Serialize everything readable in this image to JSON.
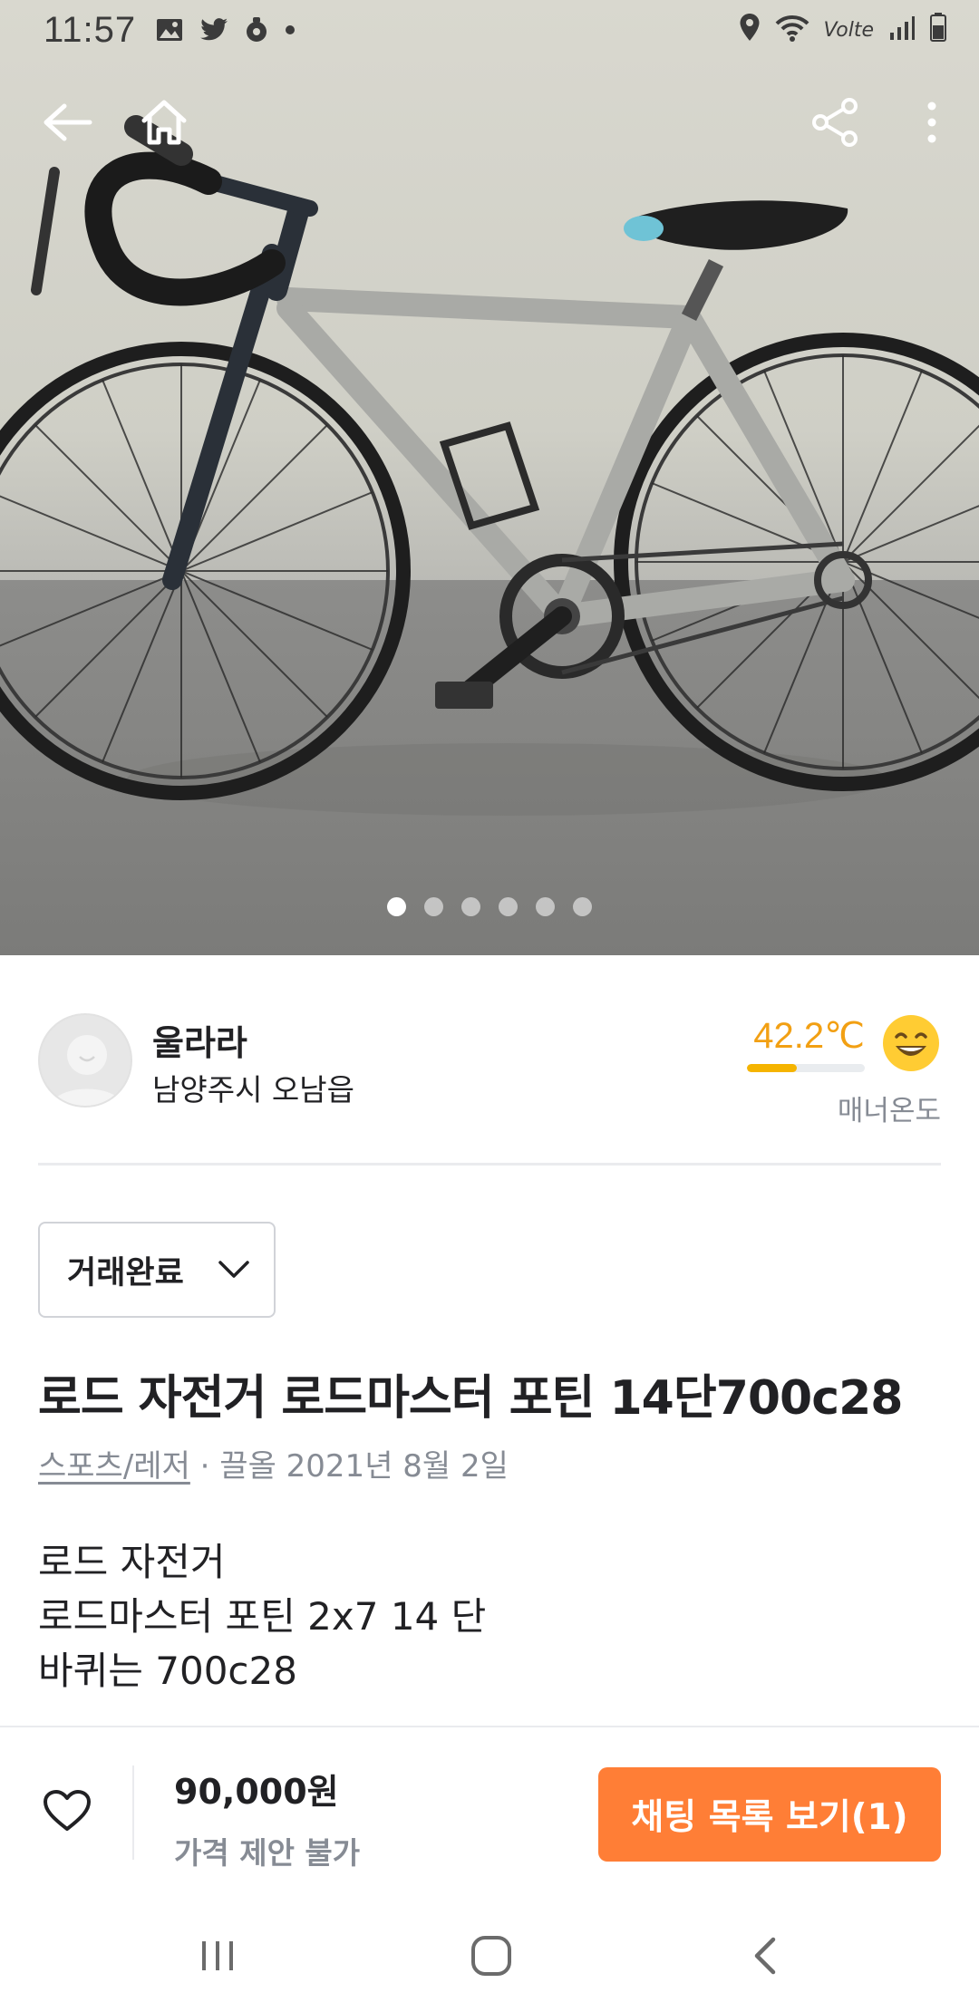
{
  "status_bar": {
    "time": "11:57",
    "network_label": "Volte"
  },
  "nav": {
    "icons": [
      "back-arrow-icon",
      "home-icon",
      "share-icon",
      "more-vertical-icon"
    ]
  },
  "carousel": {
    "total_images": 6,
    "current_index": 1
  },
  "seller": {
    "name": "울라라",
    "location": "남양주시 오남읍",
    "manner_temperature": "42.2℃",
    "manner_temperature_level": 0.42,
    "manner_label": "매너온도",
    "colors": {
      "temperature": "#f2a013"
    }
  },
  "status_select": {
    "value": "거래완료"
  },
  "listing": {
    "title": "로드 자전거 로드마스터 포틴 14단700c28",
    "category": "스포츠/레저",
    "separator": "·",
    "bumped": "끌올 2021년 8월 2일",
    "description": [
      "로드 자전거",
      "로드마스터 포틴 2x7 14 단",
      "바퀴는 700c28"
    ]
  },
  "bottom_bar": {
    "price": "90,000원",
    "price_note": "가격 제안 불가",
    "chat_button": "채팅 목록 보기(1)",
    "colors": {
      "accent": "#ff7e36"
    }
  }
}
